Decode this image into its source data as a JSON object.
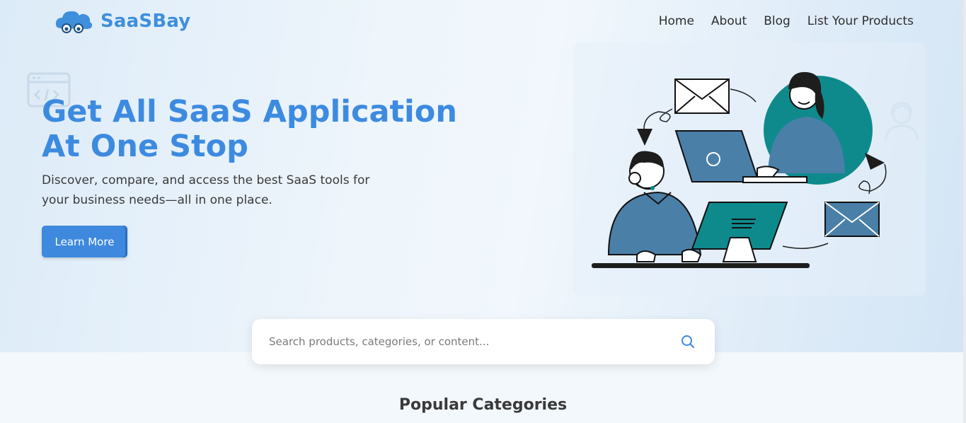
{
  "brand": {
    "name": "SaaSBay",
    "logo_icon": "cloud-logo-icon",
    "accent": "#3e89dd"
  },
  "nav": {
    "items": [
      {
        "label": "Home"
      },
      {
        "label": "About"
      },
      {
        "label": "Blog"
      },
      {
        "label": "List Your Products"
      }
    ]
  },
  "hero": {
    "title_line1": "Get All SaaS Application",
    "title_line2": "At One Stop",
    "subtitle": "Discover, compare, and access the best SaaS tools for your business needs—all in one place.",
    "cta_label": "Learn More",
    "illustration": "customer-support-illustration"
  },
  "search": {
    "placeholder": "Search products, categories, or content...",
    "value": "",
    "icon": "search-icon"
  },
  "sections": {
    "popular_title": "Popular Categories"
  }
}
